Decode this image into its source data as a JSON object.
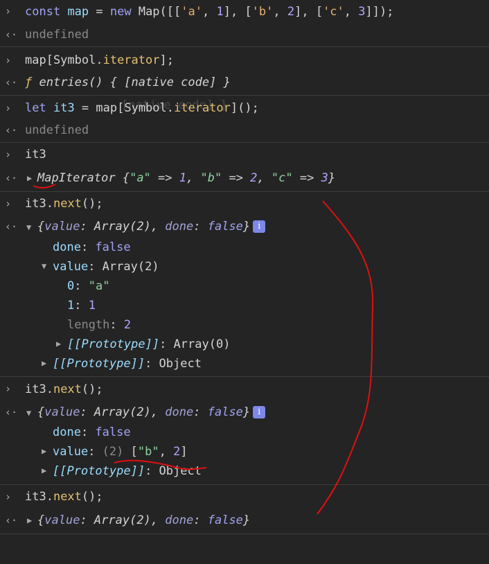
{
  "console": {
    "l1": {
      "const_kw": "const",
      "map_var": "map",
      "eq": " = ",
      "new_kw": "new",
      "map_ctor": " Map([[",
      "s_a": "'a'",
      "c1": ", ",
      "n1": "1",
      "mid1": "], [",
      "s_b": "'b'",
      "c2": ", ",
      "n2": "2",
      "mid2": "], [",
      "s_c": "'c'",
      "c3": ", ",
      "n3": "3",
      "end": "]]);"
    },
    "l2": {
      "result": "undefined"
    },
    "l3": {
      "obj": "map[Symbol.",
      "iter": "iterator",
      "end": "];"
    },
    "l4": {
      "f": "ƒ",
      "rest": " entries() { [native code] }"
    },
    "l5": {
      "let_kw": "let",
      "it3": "it3",
      "eq": " = ",
      "obj": "map[Symbol.",
      "iter": "iterator",
      "end": "]();"
    },
    "l5_ghost": "[native code] }",
    "l6": {
      "result": "undefined"
    },
    "l7": {
      "input": "it3"
    },
    "l8": {
      "name": "MapIterator",
      "open": " {",
      "ka": "\"a\"",
      "arrow1": " => ",
      "va": "1",
      "sep1": ", ",
      "kb": "\"b\"",
      "arrow2": " => ",
      "vb": "2",
      "sep2": ", ",
      "kc": "\"c\"",
      "arrow3": " => ",
      "vc": "3",
      "close": "}"
    },
    "l9": {
      "obj": "it3.",
      "next": "next",
      "end": "();"
    },
    "obj1": {
      "open": "{",
      "k1": "value",
      "colon1": ": ",
      "v1": "Array(2)",
      "sep": ", ",
      "k2": "done",
      "colon2": ": ",
      "v2": "false",
      "close": "}"
    },
    "info": "i",
    "done_row": {
      "key": "done",
      "colon": ": ",
      "val": "false"
    },
    "value_row": {
      "key": "value",
      "colon": ": ",
      "val": "Array(2)"
    },
    "item0": {
      "key": "0",
      "colon": ": ",
      "val": "\"a\""
    },
    "item1": {
      "key": "1",
      "colon": ": ",
      "val": "1"
    },
    "length_row": {
      "key": "length",
      "colon": ": ",
      "val": "2"
    },
    "proto_array": {
      "key": "[[Prototype]]",
      "colon": ": ",
      "val": "Array(0)"
    },
    "proto_obj1": {
      "key": "[[Prototype]]",
      "colon": ": ",
      "val": "Object"
    },
    "l10": {
      "obj": "it3.",
      "next": "next",
      "end": "();"
    },
    "obj2": {
      "open": "{",
      "k1": "value",
      "colon1": ": ",
      "v1": "Array(2)",
      "sep": ", ",
      "k2": "done",
      "colon2": ": ",
      "v2": "false",
      "close": "}"
    },
    "done_row2": {
      "key": "done",
      "colon": ": ",
      "val": "false"
    },
    "value_row2": {
      "key": "value",
      "colon": ": ",
      "count": "(2) ",
      "b1": "[",
      "s": "\"b\"",
      "comma": ", ",
      "n": "2",
      "b2": "]"
    },
    "proto_obj2": {
      "key": "[[Prototype]]",
      "colon": ": ",
      "val": "Object"
    },
    "l11": {
      "obj": "it3.",
      "next": "next",
      "end": "();"
    },
    "obj3": {
      "open": "{",
      "k1": "value",
      "colon1": ": ",
      "v1": "Array(2)",
      "sep": ", ",
      "k2": "done",
      "colon2": ": ",
      "v2": "false",
      "close": "}"
    }
  },
  "glyphs": {
    "prompt": "›",
    "return": "‹·",
    "expanded": "▼",
    "collapsed": "▶"
  }
}
